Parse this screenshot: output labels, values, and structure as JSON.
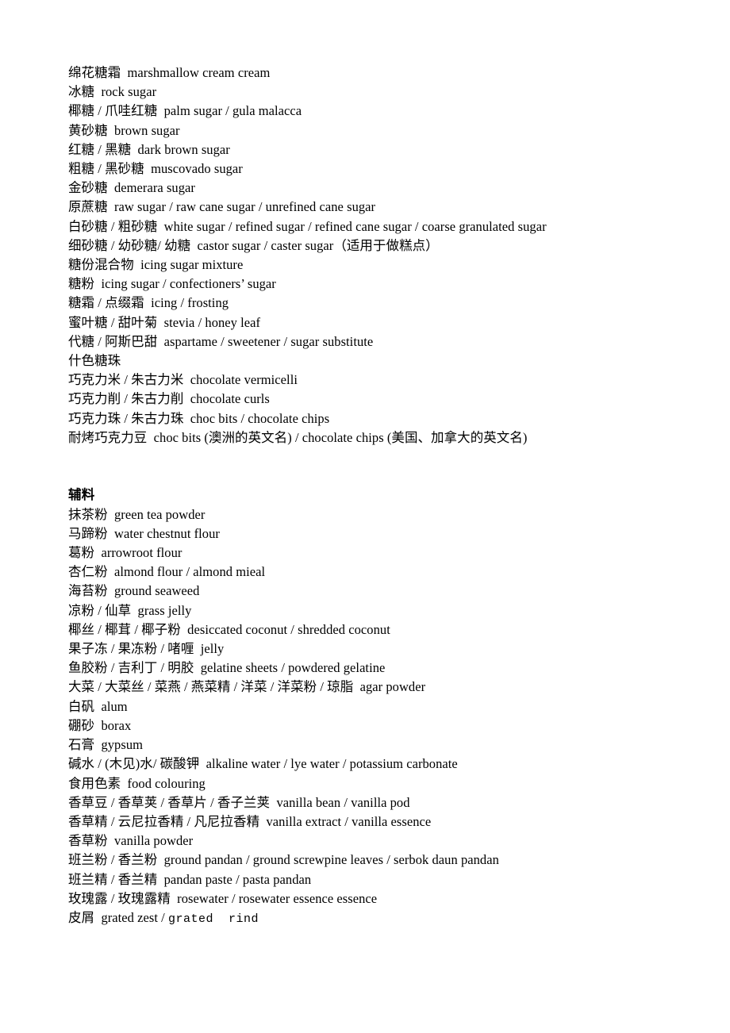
{
  "document": {
    "page_background": "#ffffff",
    "text_color": "#000000",
    "sections": [
      {
        "id": "sugars",
        "heading": null,
        "lines": [
          {
            "text": "绵花糖霜  marshmallow cream cream"
          },
          {
            "text": "冰糖  rock sugar"
          },
          {
            "text": "椰糖 / 爪哇红糖  palm sugar / gula malacca"
          },
          {
            "text": "黄砂糖  brown sugar"
          },
          {
            "text": "红糖 / 黑糖  dark brown sugar"
          },
          {
            "text": "粗糖 / 黑砂糖  muscovado sugar"
          },
          {
            "text": "金砂糖  demerara sugar"
          },
          {
            "text": "原蔗糖  raw sugar / raw cane sugar / unrefined cane sugar"
          },
          {
            "text": "白砂糖 / 粗砂糖  white sugar / refined sugar / refined cane sugar / coarse granulated sugar"
          },
          {
            "text": "细砂糖 / 幼砂糖/ 幼糖  castor sugar / caster sugar（适用于做糕点）"
          },
          {
            "text": "糖份混合物  icing sugar mixture"
          },
          {
            "text": "糖粉  icing sugar / confectioners’ sugar"
          },
          {
            "text": "糖霜 / 点缀霜  icing / frosting"
          },
          {
            "text": "蜜叶糖 / 甜叶菊  stevia / honey leaf"
          },
          {
            "text": "代糖 / 阿斯巴甜  aspartame / sweetener / sugar substitute"
          },
          {
            "text": "什色糖珠"
          },
          {
            "text": "巧克力米 / 朱古力米  chocolate vermicelli"
          },
          {
            "text": "巧克力削 / 朱古力削  chocolate curls"
          },
          {
            "text": "巧克力珠 / 朱古力珠  choc bits / chocolate chips"
          },
          {
            "text": "耐烤巧克力豆  choc bits (澳洲的英文名) / chocolate chips (美国、加拿大的英文名)"
          }
        ]
      },
      {
        "id": "auxiliary-ingredients",
        "heading": "辅料",
        "lines": [
          {
            "text": "抹茶粉  green tea powder"
          },
          {
            "text": "马蹄粉  water chestnut flour"
          },
          {
            "text": "葛粉  arrowroot flour"
          },
          {
            "text": "杏仁粉  almond flour / almond mieal"
          },
          {
            "text": "海苔粉  ground seaweed"
          },
          {
            "text": "凉粉 / 仙草  grass jelly"
          },
          {
            "text": "椰丝 / 椰茸 / 椰子粉  desiccated coconut / shredded coconut"
          },
          {
            "text": "果子冻 / 果冻粉 / 啫喱  jelly"
          },
          {
            "text": "鱼胶粉 / 吉利丁 / 明胶  gelatine sheets / powdered gelatine"
          },
          {
            "text": "大菜 / 大菜丝 / 菜燕 / 燕菜精 / 洋菜 / 洋菜粉 / 琼脂  agar powder"
          },
          {
            "text": "白矾  alum"
          },
          {
            "text": "硼砂  borax"
          },
          {
            "text": "石膏  gypsum"
          },
          {
            "text": "碱水 / (木见)水/ 碳酸钾  alkaline water / lye water / potassium carbonate"
          },
          {
            "text": "食用色素  food colouring"
          },
          {
            "text": "香草豆 / 香草荚 / 香草片 / 香子兰荚  vanilla bean / vanilla pod"
          },
          {
            "text": "香草精 / 云尼拉香精 / 凡尼拉香精  vanilla extract / vanilla essence"
          },
          {
            "text": "香草粉  vanilla powder"
          },
          {
            "text": "班兰粉 / 香兰粉  ground pandan / ground screwpine leaves / serbok daun pandan"
          },
          {
            "text": "班兰精 / 香兰精  pandan paste / pasta pandan"
          },
          {
            "text": "玫瑰露 / 玫瑰露精  rosewater / rosewater essence essence"
          },
          {
            "text": "皮屑  grated zest / ",
            "mono_suffix": "grated  rind"
          }
        ]
      }
    ]
  }
}
